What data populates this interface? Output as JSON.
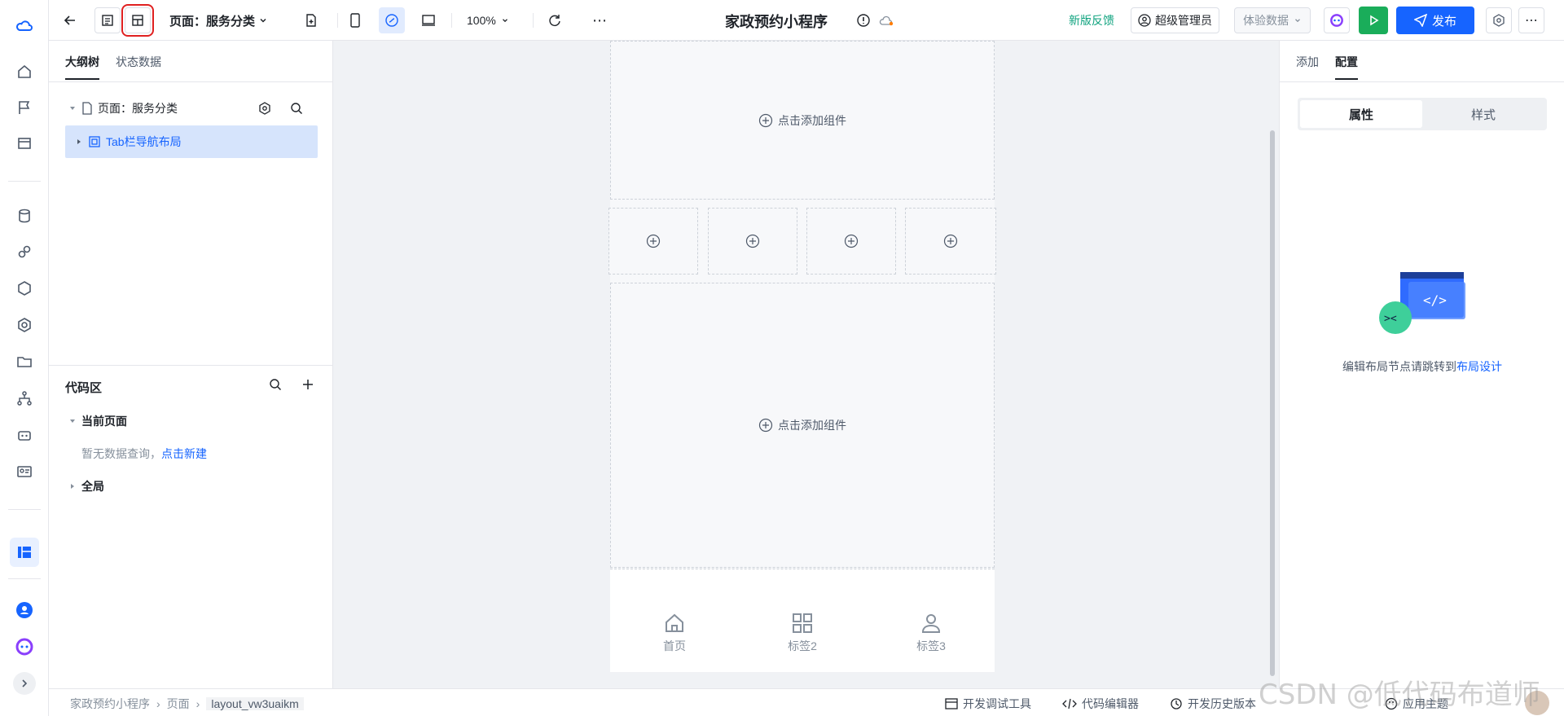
{
  "topbar": {
    "page_select": "页面：服务分类",
    "zoom": "100%",
    "app_title": "家政预约小程序",
    "feedback": "新版反馈",
    "role": "超级管理员",
    "data_env": "体验数据",
    "publish": "发布"
  },
  "left_panel": {
    "tabs": [
      "大纲树",
      "状态数据"
    ],
    "tree_page": "页面：服务分类",
    "tree_node": "Tab栏导航布局",
    "code_title": "代码区",
    "current_page": "当前页面",
    "empty_query": "暂无数据查询，",
    "create_new": "点击新建",
    "global": "全局"
  },
  "canvas": {
    "add_component": "点击添加组件",
    "tabs": [
      "首页",
      "标签2",
      "标签3"
    ]
  },
  "right_panel": {
    "tabs": [
      "添加",
      "配置"
    ],
    "segments": [
      "属性",
      "样式"
    ],
    "hint": "编辑布局节点请跳转到",
    "hint_link": "布局设计"
  },
  "footer": {
    "crumbs": [
      "家政预约小程序",
      "页面",
      "layout_vw3uaikm"
    ],
    "dev_tools": "开发调试工具",
    "code_editor": "代码编辑器",
    "history": "开发历史版本",
    "theme": "应用主题"
  },
  "watermark": "CSDN @低代码布道师"
}
